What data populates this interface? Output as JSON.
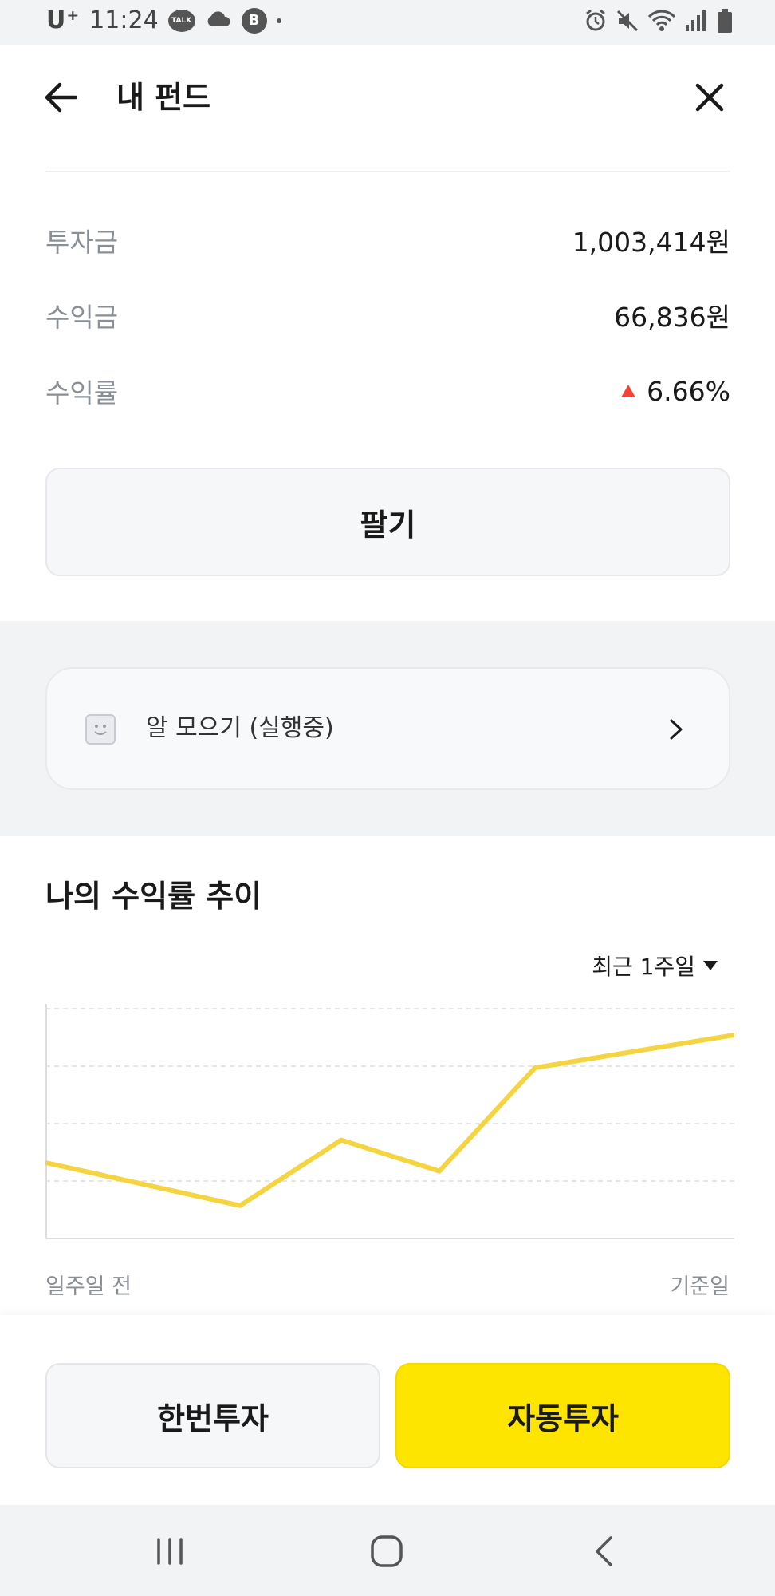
{
  "status_bar": {
    "carrier": "U⁺",
    "time": "11:24",
    "talk_badge": "TALK",
    "b_badge": "B",
    "icons": [
      "talk-icon",
      "cloud-icon",
      "b-icon",
      "alarm-icon",
      "mute-icon",
      "wifi-icon",
      "signal-icon",
      "battery-icon"
    ]
  },
  "header": {
    "title": "내 펀드"
  },
  "summary": {
    "rows": [
      {
        "label": "투자금",
        "value": "1,003,414원"
      },
      {
        "label": "수익금",
        "value": "66,836원"
      },
      {
        "label": "수익률",
        "value": "6.66%",
        "trend": "up"
      }
    ]
  },
  "sell_button": "팔기",
  "saving_card": {
    "label": "알 모으기 (실행중)"
  },
  "chart_section": {
    "title": "나의 수익률 추이",
    "period": "최근 1주일",
    "x_start_label": "일주일 전",
    "x_end_label": "기준일"
  },
  "chart_data": {
    "type": "line",
    "x": [
      0,
      1,
      2,
      3,
      4,
      5,
      6,
      7
    ],
    "values": [
      2.3,
      1.65,
      1.0,
      3.0,
      2.05,
      5.2,
      6.2
    ],
    "ylim": [
      0,
      7
    ],
    "grid": true,
    "color": "#f5d442"
  },
  "bottom_buttons": {
    "once": "한번투자",
    "auto": "자동투자"
  },
  "colors": {
    "accent_yellow": "#fee500",
    "up_red": "#f04438",
    "line_yellow": "#f5d442"
  }
}
